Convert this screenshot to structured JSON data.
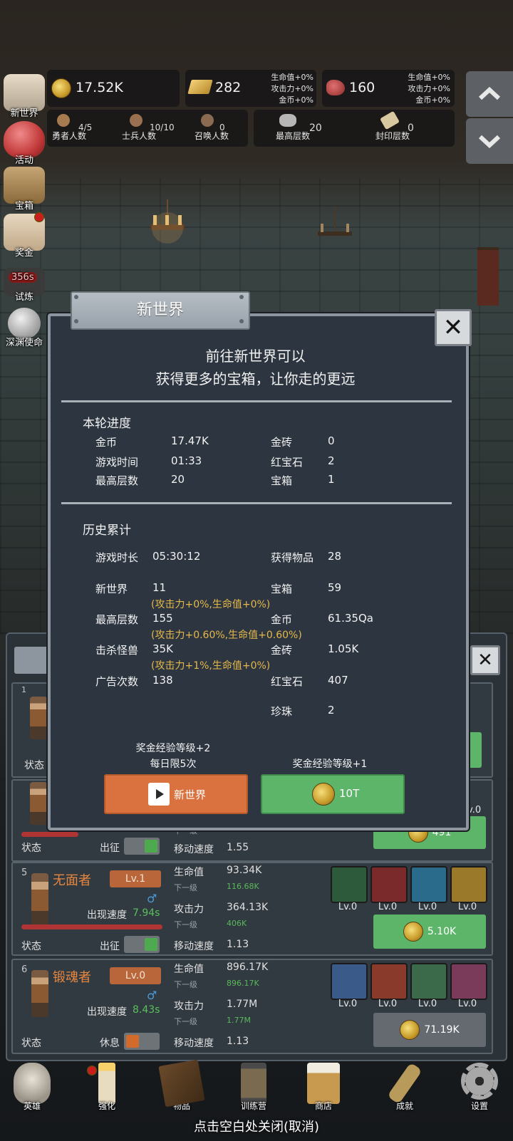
{
  "top": {
    "gold": "17.52K",
    "brick": "282",
    "brick_bonus": [
      "生命值+0%",
      "攻击力+0%",
      "金币+0%"
    ],
    "ruby": "160",
    "ruby_bonus": [
      "生命值+0%",
      "攻击力+0%",
      "金币+0%"
    ],
    "stats": [
      {
        "value": "4/5",
        "label": "勇者人数"
      },
      {
        "value": "10/10",
        "label": "士兵人数"
      },
      {
        "value": "0",
        "label": "召唤人数"
      },
      {
        "value": "20",
        "label": "最高层数"
      },
      {
        "value": "0",
        "label": "封印层数"
      }
    ]
  },
  "sidebar": {
    "items": [
      {
        "label": "新世界"
      },
      {
        "label": "活动"
      },
      {
        "label": "宝箱"
      },
      {
        "label": "奖金"
      },
      {
        "label": "试炼",
        "timer": "356s"
      },
      {
        "label": "深渊使命"
      }
    ]
  },
  "heroes": {
    "card4": {
      "status_label": "状态",
      "deploy_label": "出征",
      "move_speed_label": "移动速度",
      "move_speed": "1.55",
      "next_label": "下一级",
      "cost": "491"
    },
    "card5": {
      "index": "5",
      "name": "无面者",
      "level": "Lv.1",
      "spawn_label": "出现速度",
      "spawn_speed": "7.94s",
      "hp_label": "生命值",
      "hp": "93.34K",
      "next_label": "下一级",
      "hp_next": "116.68K",
      "atk_label": "攻击力",
      "atk": "364.13K",
      "atk_next": "406K",
      "move_speed_label": "移动速度",
      "move_speed": "1.13",
      "status_label": "状态",
      "deploy_label": "出征",
      "cost": "5.10K",
      "skills": [
        "Lv.0",
        "Lv.0",
        "Lv.0",
        "Lv.0"
      ]
    },
    "card6": {
      "index": "6",
      "name": "锻魂者",
      "level": "Lv.0",
      "spawn_label": "出现速度",
      "spawn_speed": "8.43s",
      "hp_label": "生命值",
      "hp": "896.17K",
      "next_label": "下一级",
      "hp_next": "896.17K",
      "atk_label": "攻击力",
      "atk": "1.77M",
      "atk_next": "1.77M",
      "move_speed_label": "移动速度",
      "move_speed": "1.13",
      "status_label": "状态",
      "rest_label": "休息",
      "cost": "71.19K",
      "skills": [
        "Lv.0",
        "Lv.0",
        "Lv.0",
        "Lv.0"
      ]
    },
    "card1": {
      "index": "1",
      "status_label": "状态"
    },
    "card4_skill_lv": "Lv.0"
  },
  "dialog": {
    "title": "新世界",
    "desc1": "前往新世界可以",
    "desc2": "获得更多的宝箱，让你走的更远",
    "round": {
      "heading": "本轮进度",
      "gold_label": "金币",
      "gold": "17.47K",
      "time_label": "游戏时间",
      "time": "01:33",
      "floor_label": "最高层数",
      "floor": "20",
      "brick_label": "金砖",
      "brick": "0",
      "ruby_label": "红宝石",
      "ruby": "2",
      "chest_label": "宝箱",
      "chest": "1"
    },
    "history": {
      "heading": "历史累计",
      "playtime_label": "游戏时长",
      "playtime": "05:30:12",
      "newworld_label": "新世界",
      "newworld": "11",
      "newworld_bonus": "(攻击力+0%,生命值+0%)",
      "floor_label": "最高层数",
      "floor": "155",
      "floor_bonus": "(攻击力+0.60%,生命值+0.60%)",
      "kills_label": "击杀怪兽",
      "kills": "35K",
      "kills_bonus": "(攻击力+1%,生命值+0%)",
      "ads_label": "广告次数",
      "ads": "138",
      "items_label": "获得物品",
      "items": "28",
      "chest_label": "宝箱",
      "chest": "59",
      "gold_label": "金币",
      "gold": "61.35Qa",
      "brick_label": "金砖",
      "brick": "1.05K",
      "ruby_label": "红宝石",
      "ruby": "407",
      "pearl_label": "珍珠",
      "pearl": "2"
    },
    "left_reward_line1": "奖金经验等级+2",
    "left_reward_line2": "每日限5次",
    "right_reward": "奖金经验等级+1",
    "left_button": "新世界",
    "right_button": "10T"
  },
  "nav": {
    "items": [
      {
        "label": "英雄"
      },
      {
        "label": "强化"
      },
      {
        "label": "物品"
      },
      {
        "label": "训练营"
      },
      {
        "label": "商店"
      },
      {
        "label": "成就"
      },
      {
        "label": "设置"
      }
    ]
  },
  "hint": "点击空白处关闭(取消)",
  "colors": {
    "dialog_bg": "#2c3540",
    "orange_button": "#d9723e",
    "green_button": "#5db56a",
    "bonus_gold": "#e5b94a",
    "name_orange": "#e7863f"
  }
}
